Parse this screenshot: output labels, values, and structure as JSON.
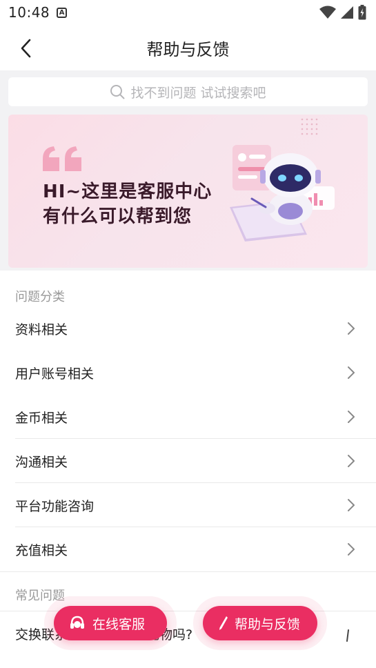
{
  "status_bar": {
    "time": "10:48",
    "notif_glyph": "A"
  },
  "nav": {
    "title": "帮助与反馈"
  },
  "search": {
    "placeholder": "找不到问题 试试搜索吧"
  },
  "banner": {
    "line1": "HI~这里是客服中心",
    "line2": "有什么可以帮到您"
  },
  "categories": {
    "label": "问题分类",
    "items": [
      {
        "label": "资料相关"
      },
      {
        "label": "用户账号相关"
      },
      {
        "label": "金币相关"
      },
      {
        "label": "沟通相关"
      },
      {
        "label": "平台功能咨询"
      },
      {
        "label": "充值相关"
      }
    ]
  },
  "faq": {
    "label": "常见问题",
    "items": [
      {
        "label": "交换联系方式需要赠送礼物吗?"
      }
    ]
  },
  "buttons": {
    "service": "在线客服",
    "feedback": "帮助与反馈"
  },
  "colors": {
    "accent": "#ea2e62",
    "banner_bg": "#fbdde6",
    "page_bg": "#f2f2f4"
  },
  "icons": [
    "back-arrow-icon",
    "search-icon",
    "quote-icon",
    "robot-illustration",
    "chevron-right-icon",
    "headset-icon",
    "pen-icon",
    "wifi-icon",
    "signal-icon",
    "battery-icon"
  ]
}
